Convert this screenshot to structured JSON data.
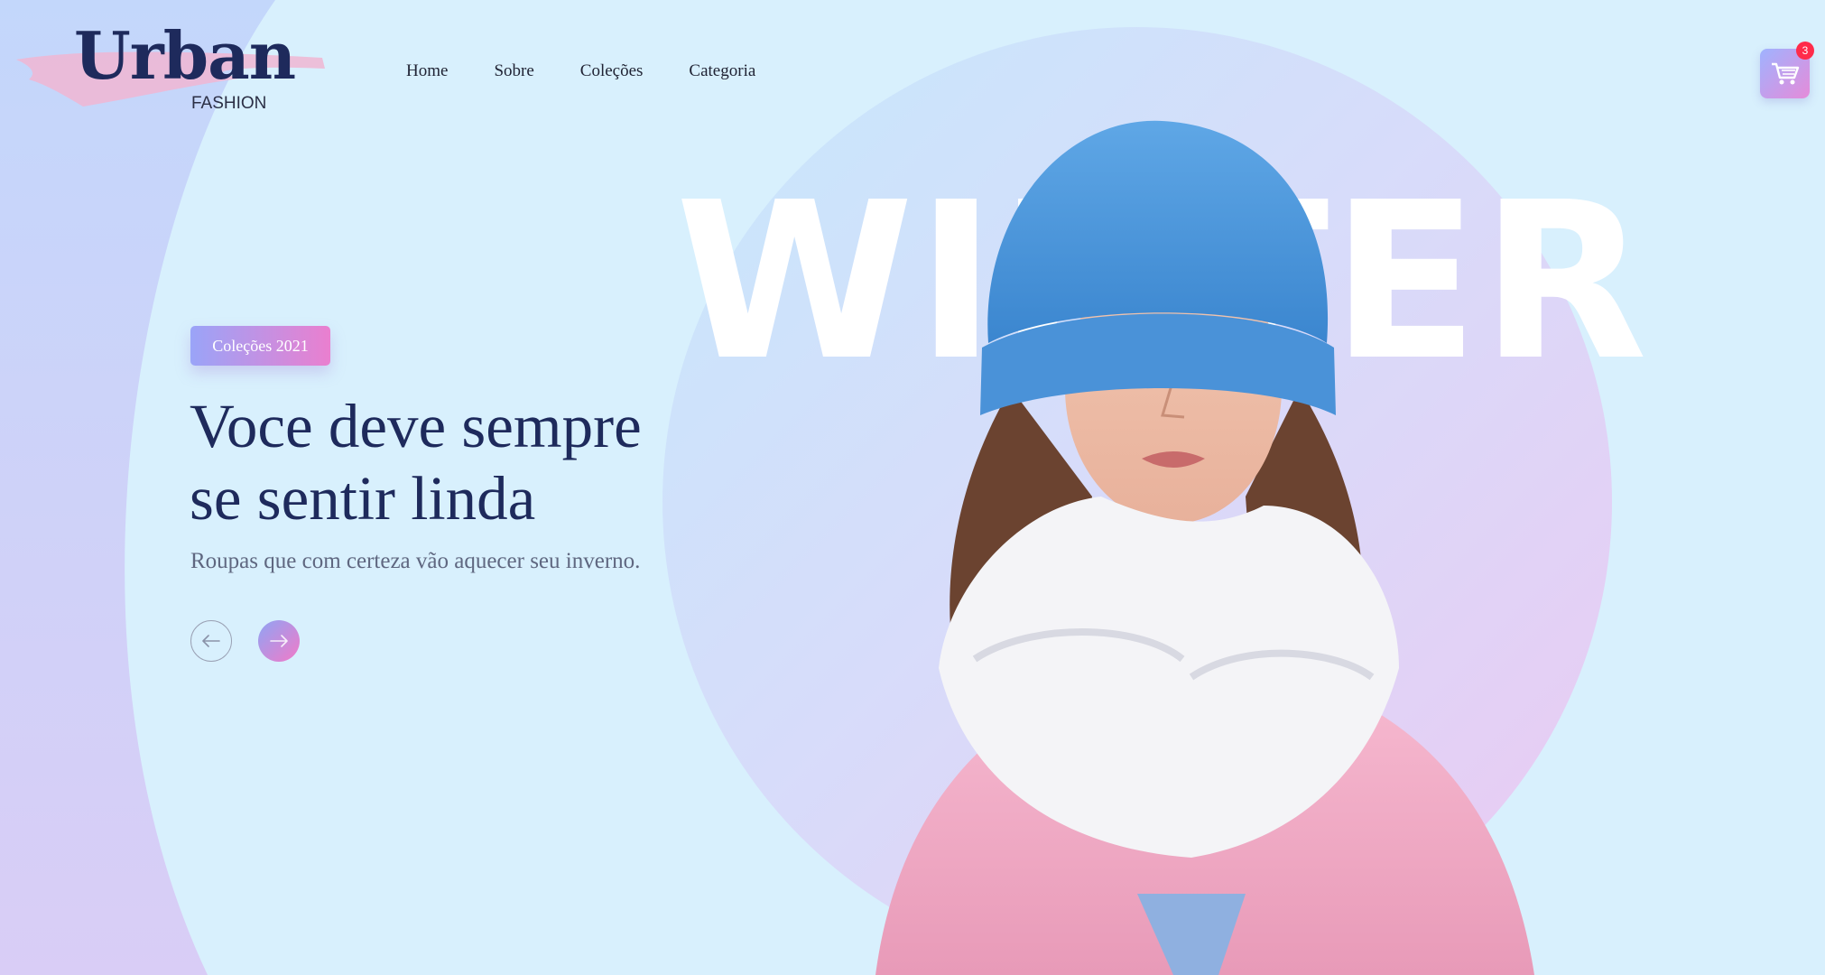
{
  "brand": {
    "name": "Urban",
    "tagline": "FASHION"
  },
  "nav": {
    "items": [
      {
        "label": "Home"
      },
      {
        "label": "Sobre"
      },
      {
        "label": "Coleções"
      },
      {
        "label": "Categoria"
      }
    ]
  },
  "cart": {
    "count": "3",
    "icon": "cart-icon"
  },
  "hero": {
    "badge": "Coleções 2021",
    "headline_line1": "Voce deve sempre",
    "headline_line2": "se sentir linda",
    "subtitle": "Roupas que com certeza vão aquecer seu inverno.",
    "background_word": "WINTER",
    "prev_icon": "arrow-left-icon",
    "next_icon": "arrow-right-icon"
  },
  "colors": {
    "background": "#d8f0fd",
    "navy": "#1e2a5c",
    "gradient_start": "#9aa4f8",
    "gradient_end": "#ea7fcf",
    "badge_red": "#ff2b4a"
  }
}
